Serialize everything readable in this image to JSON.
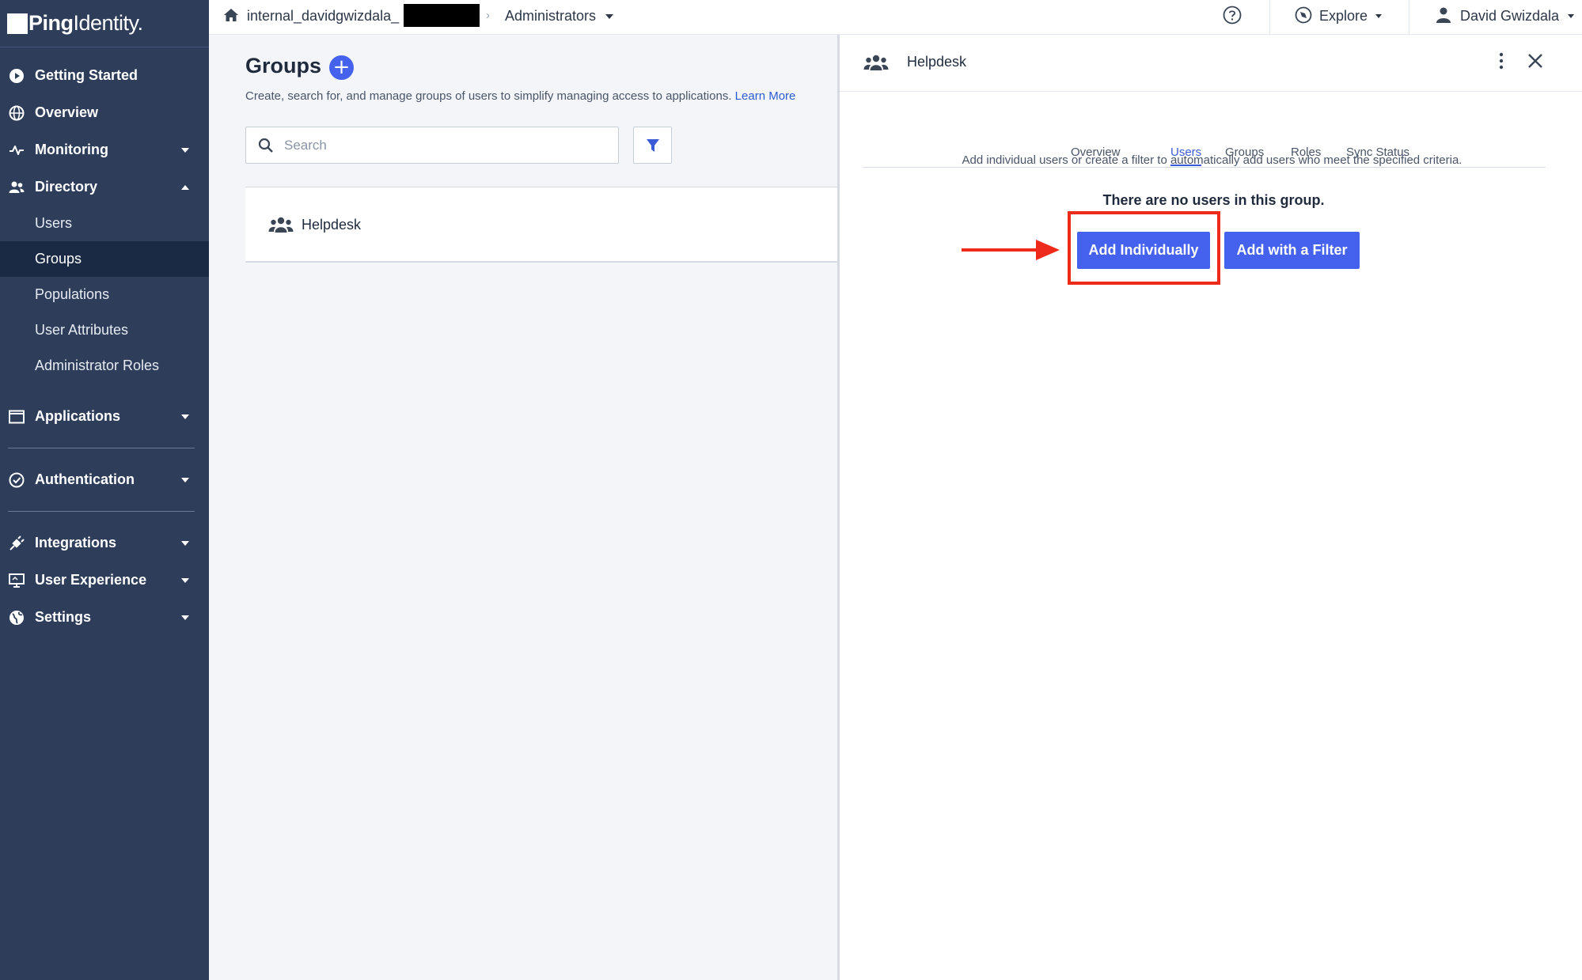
{
  "brand": {
    "logo_bold": "Ping",
    "logo_light": "Identity.",
    "accent": "#4462ed",
    "sidebar_bg": "#2e3e5a",
    "highlight": "#ee2a1a"
  },
  "topbar": {
    "environment": "internal_davidgwizdala_",
    "breadcrumb_separator": "›",
    "role_selector": "Administrators",
    "explore": "Explore",
    "user": "David Gwizdala"
  },
  "sidebar": {
    "items": [
      {
        "label": "Getting Started",
        "icon": "play-circle-icon"
      },
      {
        "label": "Overview",
        "icon": "globe-icon"
      },
      {
        "label": "Monitoring",
        "icon": "pulse-icon"
      },
      {
        "label": "Directory",
        "icon": "users-icon"
      },
      {
        "label": "Applications",
        "icon": "window-icon"
      },
      {
        "label": "Authentication",
        "icon": "check-circle-icon"
      },
      {
        "label": "Integrations",
        "icon": "plug-icon"
      },
      {
        "label": "User Experience",
        "icon": "monitor-icon"
      },
      {
        "label": "Settings",
        "icon": "globe-settings-icon"
      }
    ],
    "directory_subitems": [
      "Users",
      "Groups",
      "Populations",
      "User Attributes",
      "Administrator Roles"
    ],
    "active_subitem": "Groups"
  },
  "main": {
    "title": "Groups",
    "description": "Create, search for, and manage groups of users to simplify managing access to applications.",
    "learn_more": "Learn More",
    "search_placeholder": "Search",
    "groups": [
      {
        "name": "Helpdesk"
      }
    ]
  },
  "panel": {
    "title": "Helpdesk",
    "tabs": [
      "Overview",
      "Users",
      "Groups",
      "Roles",
      "Sync Status"
    ],
    "active_tab": "Users",
    "description": "Add individual users or create a filter to automatically add users who meet the specified criteria.",
    "empty_message": "There are no users in this group.",
    "add_individually": "Add Individually",
    "add_with_filter": "Add with a Filter"
  }
}
